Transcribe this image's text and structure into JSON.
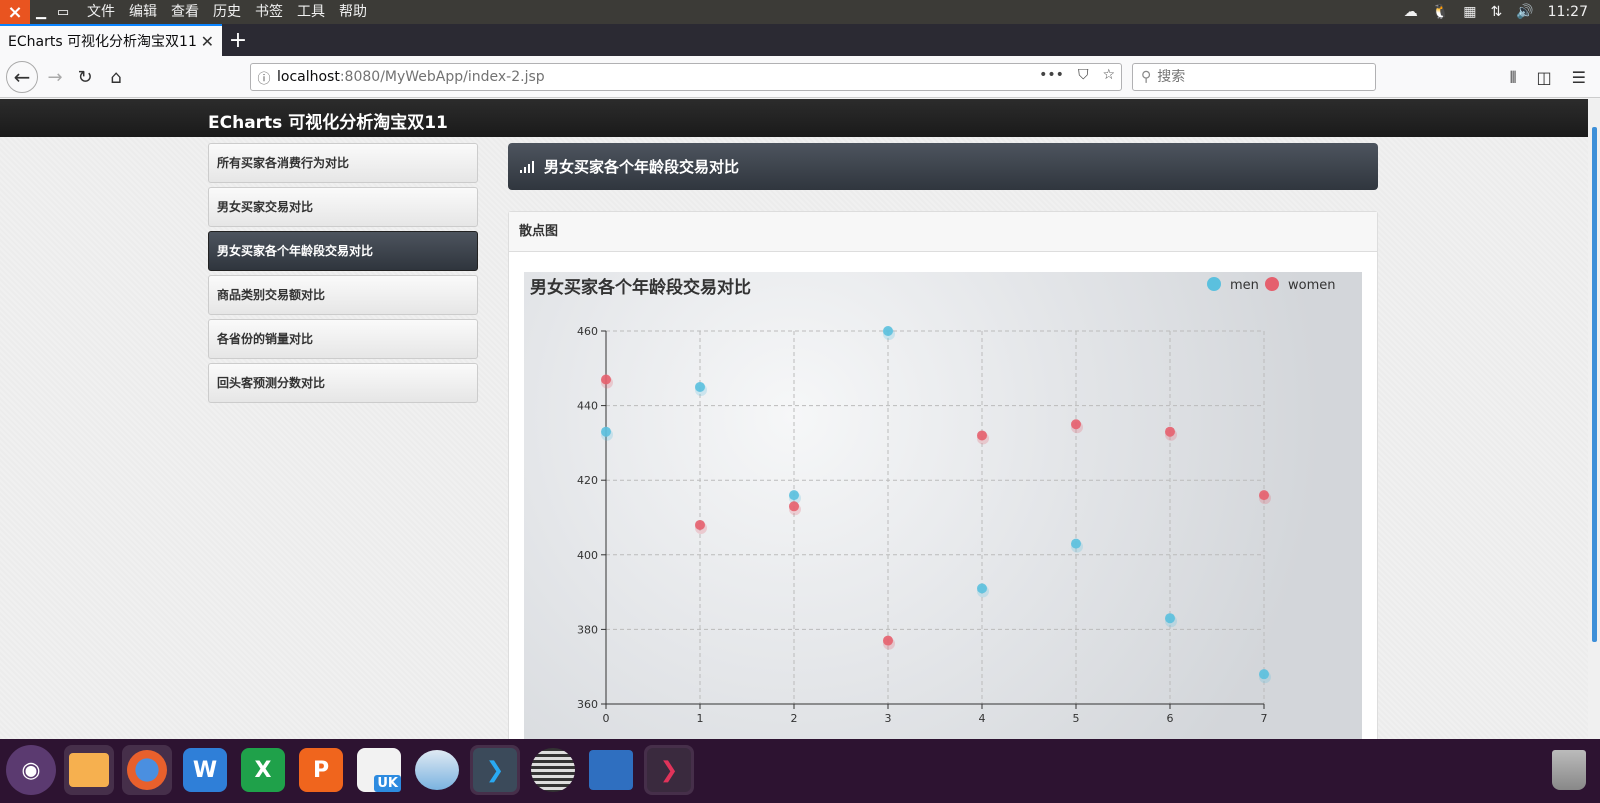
{
  "top_panel": {
    "menu": [
      "文件",
      "编辑",
      "查看",
      "历史",
      "书签",
      "工具",
      "帮助"
    ],
    "clock": "11:27"
  },
  "browser": {
    "tab_title": "ECharts 可视化分析淘宝双11",
    "url_host": "localhost",
    "url_rest": ":8080/MyWebApp/index-2.jsp",
    "search_placeholder": "搜索"
  },
  "site": {
    "title": "ECharts 可视化分析淘宝双11",
    "sidebar": [
      {
        "label": "所有买家各消费行为对比"
      },
      {
        "label": "男女买家交易对比"
      },
      {
        "label": "男女买家各个年龄段交易对比",
        "active": true
      },
      {
        "label": "商品类别交易额对比"
      },
      {
        "label": "各省份的销量对比"
      },
      {
        "label": "回头客预测分数对比"
      }
    ],
    "panel_title": "男女买家各个年龄段交易对比",
    "card_title": "散点图"
  },
  "chart_data": {
    "type": "scatter",
    "title": "男女买家各个年龄段交易对比",
    "legend_position": "top-right",
    "xlim": [
      0,
      7
    ],
    "ylim": [
      360,
      460
    ],
    "x_ticks": [
      0,
      1,
      2,
      3,
      4,
      5,
      6,
      7
    ],
    "y_ticks": [
      360,
      380,
      400,
      420,
      440,
      460
    ],
    "grid": true,
    "series": [
      {
        "name": "men",
        "color": "#5bc0de",
        "points": [
          [
            0,
            433
          ],
          [
            1,
            445
          ],
          [
            2,
            416
          ],
          [
            3,
            460
          ],
          [
            4,
            391
          ],
          [
            5,
            403
          ],
          [
            6,
            383
          ],
          [
            7,
            368
          ]
        ]
      },
      {
        "name": "women",
        "color": "#e5606e",
        "points": [
          [
            0,
            447
          ],
          [
            1,
            408
          ],
          [
            2,
            413
          ],
          [
            3,
            377
          ],
          [
            4,
            432
          ],
          [
            5,
            435
          ],
          [
            6,
            433
          ],
          [
            7,
            416
          ]
        ]
      }
    ]
  }
}
